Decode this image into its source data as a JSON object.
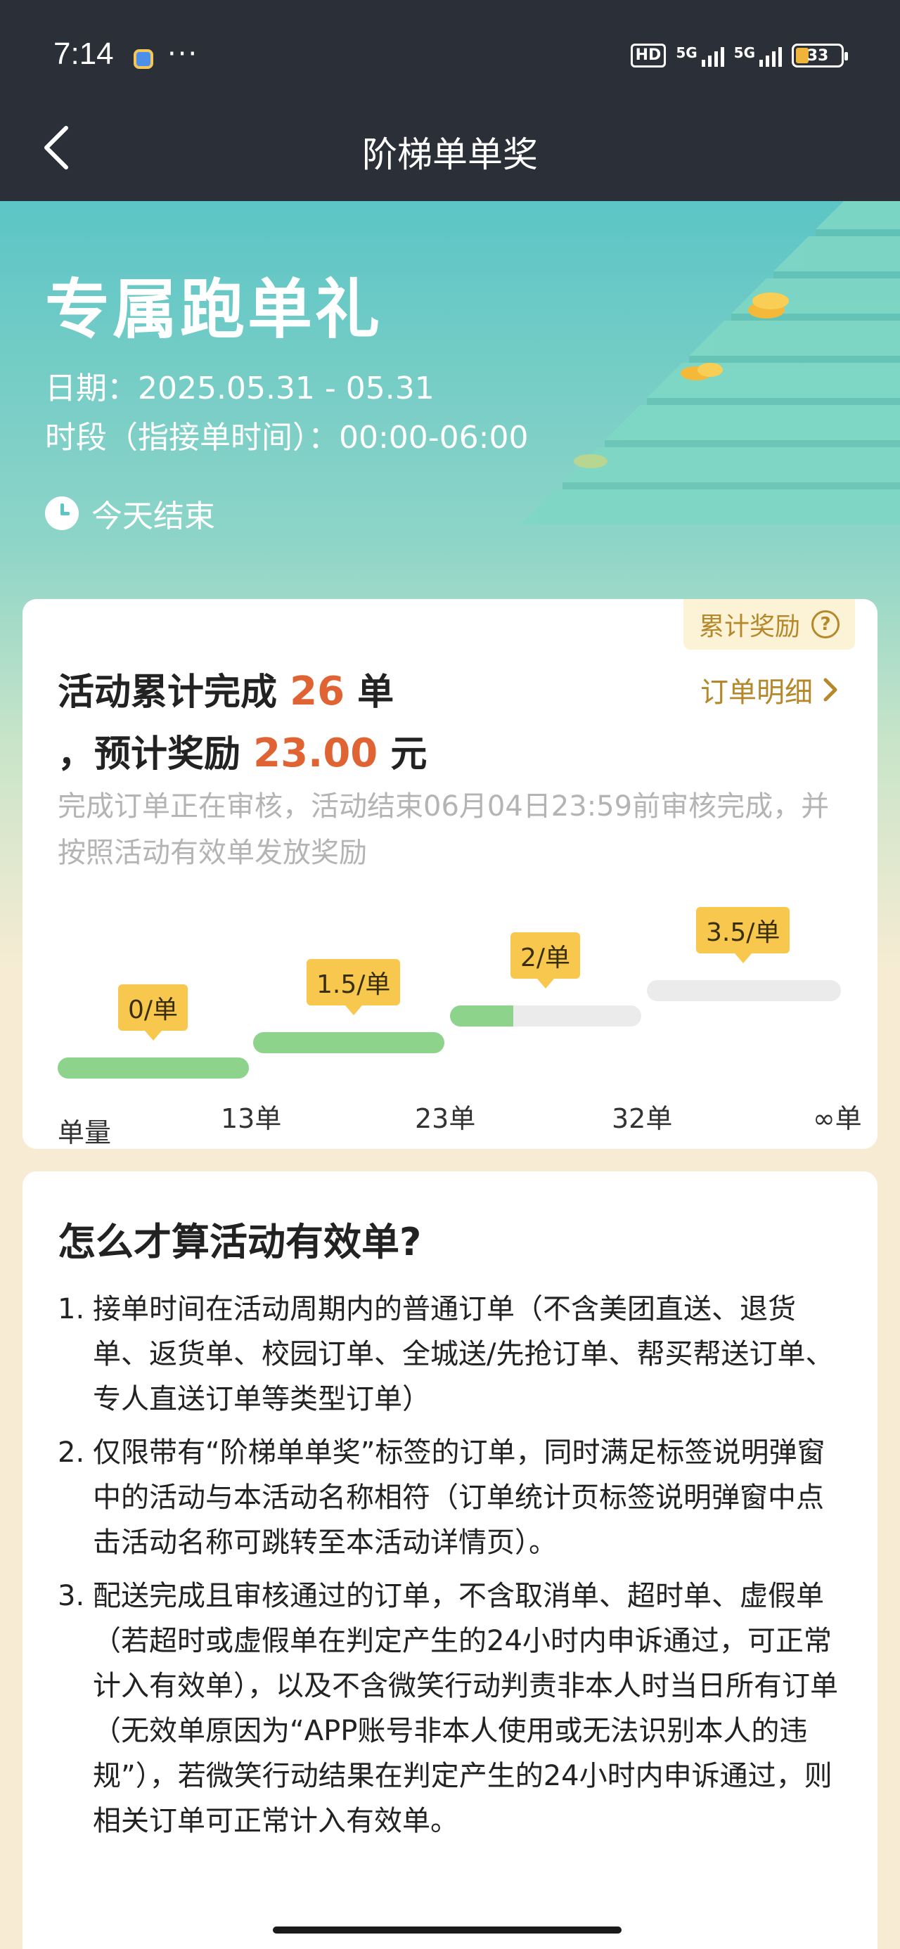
{
  "status_bar": {
    "time": "7:14",
    "dots": "···",
    "hd_label": "HD",
    "signal1_label": "5G",
    "signal2_label": "5G",
    "battery": "33"
  },
  "nav": {
    "title": "阶梯单单奖"
  },
  "hero": {
    "title": "专属跑单礼",
    "date": "日期：2025.05.31 - 05.31",
    "period": "时段（指接单时间）：00:00-06:00",
    "ends": "今天结束"
  },
  "summary": {
    "cumulative_badge": "累计奖励",
    "help_glyph": "?",
    "line1_prefix": "活动累计完成 ",
    "completed_count": "26",
    "line1_suffix": " 单",
    "line2_prefix": "，预计奖励 ",
    "reward_amount": "23.00",
    "line2_suffix": " 元",
    "order_detail_link": "订单明细",
    "notice": "完成订单正在审核，活动结束06月04日23:59前审核完成，并按照活动有效单发放奖励"
  },
  "tiers": {
    "bubbles": [
      "0/单",
      "1.5/单",
      "2/单",
      "3.5/单"
    ],
    "fill_fraction": [
      1,
      1,
      0.33,
      0
    ],
    "axis_labels": [
      "单量",
      "13单",
      "23单",
      "32单",
      "∞单"
    ]
  },
  "rules": {
    "title": "怎么才算活动有效单?",
    "items": [
      {
        "num": "1.",
        "text": "接单时间在活动周期内的普通订单（不含美团直送、退货单、返货单、校园订单、全城送/先抢订单、帮买帮送订单、专人直送订单等类型订单）"
      },
      {
        "num": "2.",
        "text": "仅限带有“阶梯单单奖”标签的订单，同时满足标签说明弹窗中的活动与本活动名称相符（订单统计页标签说明弹窗中点击活动名称可跳转至本活动详情页）。"
      },
      {
        "num": "3.",
        "text": "配送完成且审核通过的订单，不含取消单、超时单、虚假单（若超时或虚假单在判定产生的24小时内申诉通过，可正常计入有效单），以及不含微笑行动判责非本人时当日所有订单（无效单原因为“APP账号非本人使用或无法识别本人的违规”），若微笑行动结果在判定产生的24小时内申诉通过，则相关订单可正常计入有效单。"
      }
    ]
  },
  "colors": {
    "nav_bg": "#2b2f37",
    "accent_number": "#e06433",
    "link_gold": "#b5882c",
    "bar_fill": "#8ed38c",
    "bubble": "#f8c84e"
  }
}
